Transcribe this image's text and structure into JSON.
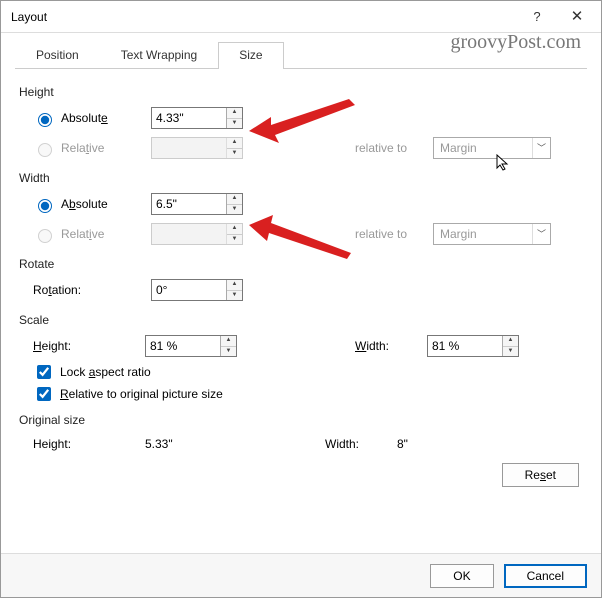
{
  "window": {
    "title": "Layout"
  },
  "watermark": "groovyPost.com",
  "tabs": {
    "position": "Position",
    "textwrap": "Text Wrapping",
    "size": "Size"
  },
  "sections": {
    "height": "Height",
    "width": "Width",
    "rotate": "Rotate",
    "scale": "Scale",
    "original": "Original size"
  },
  "labels": {
    "absolute_h": "Absolute",
    "relative_h": "Relative",
    "absolute_w": "Absolute",
    "relative_w": "Relative",
    "rotation": "Rotation:",
    "scale_height": "Height:",
    "scale_width": "Width:",
    "lock_aspect": "Lock aspect ratio",
    "rel_orig": "Relative to original picture size",
    "orig_height": "Height:",
    "orig_width": "Width:",
    "relative_to": "relative to"
  },
  "values": {
    "height_abs": "4.33\"",
    "height_rel": "",
    "width_abs": "6.5\"",
    "width_rel": "",
    "rotation": "0°",
    "scale_h": "81 %",
    "scale_w": "81 %",
    "orig_h": "5.33\"",
    "orig_w": "8\"",
    "rel_to_h": "Margin",
    "rel_to_w": "Margin"
  },
  "buttons": {
    "reset": "Reset",
    "ok": "OK",
    "cancel": "Cancel"
  },
  "checks": {
    "lock": true,
    "relorig": true
  }
}
